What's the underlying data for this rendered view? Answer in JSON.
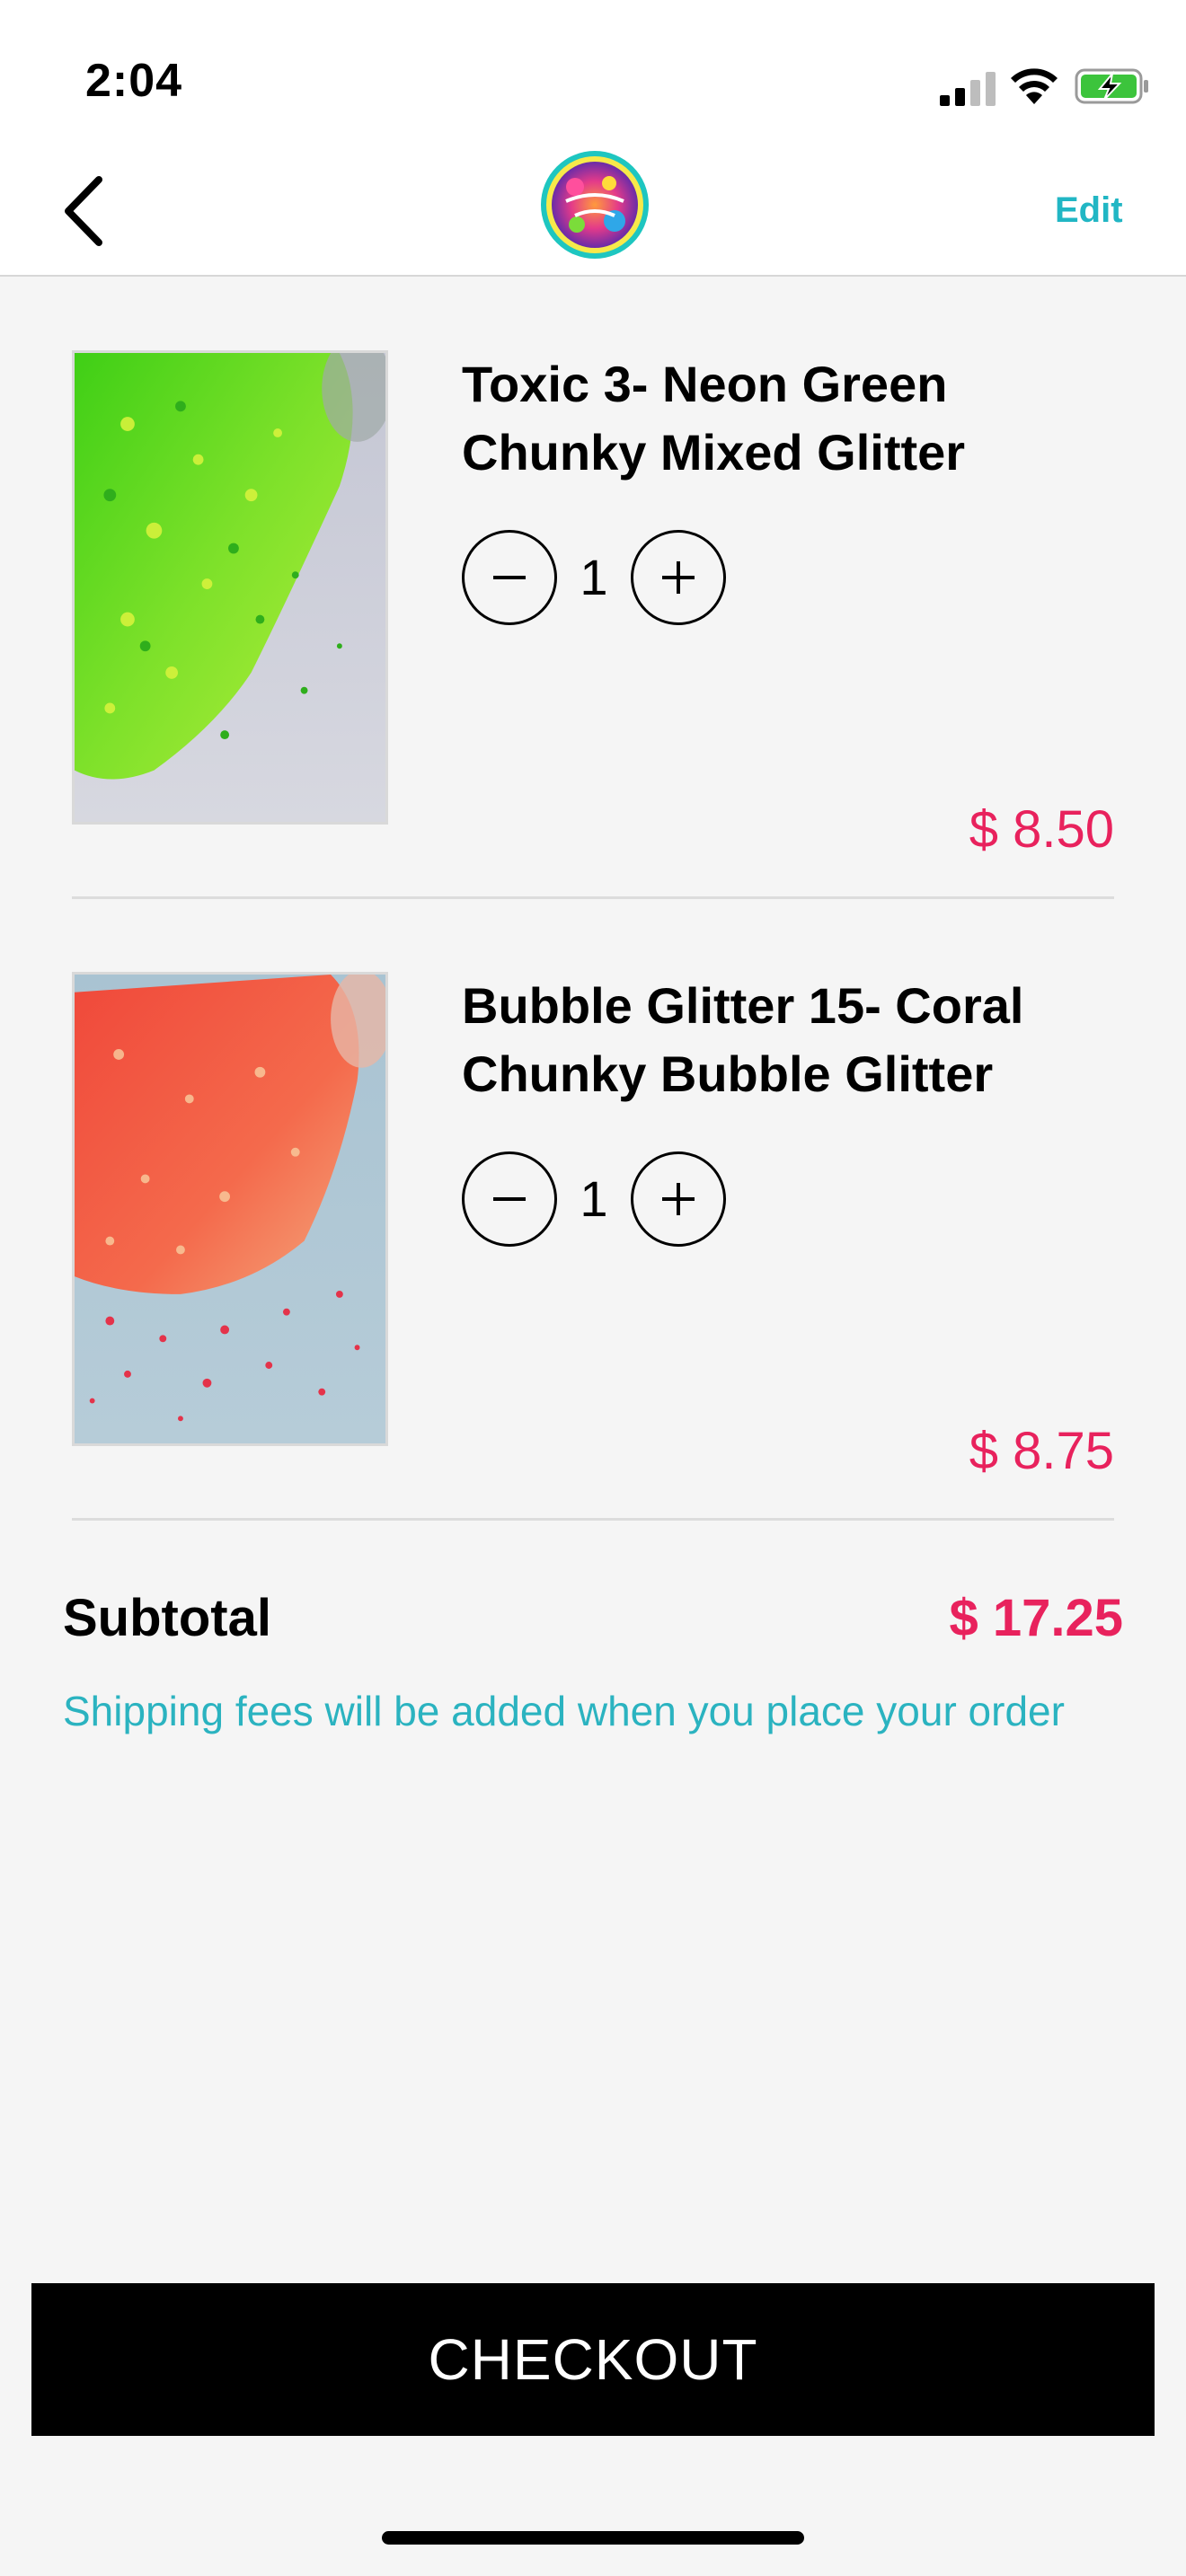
{
  "status_bar": {
    "time": "2:04"
  },
  "nav": {
    "logo_alt": "Custom by Estee",
    "edit_label": "Edit"
  },
  "cart": {
    "items": [
      {
        "title_line1": "Toxic 3- Neon Green",
        "title_line2": "Chunky Mixed Glitter",
        "quantity": "1",
        "price": "$ 8.50",
        "thumb_colors": [
          "#4fd41e",
          "#9ef23a",
          "#c9c9d6"
        ]
      },
      {
        "title_line1": "Bubble Glitter 15- Coral",
        "title_line2": "Chunky Bubble Glitter",
        "quantity": "1",
        "price": "$ 8.75",
        "thumb_colors": [
          "#ef4a3a",
          "#f7a07a",
          "#a8c4d0"
        ]
      }
    ]
  },
  "summary": {
    "subtotal_label": "Subtotal",
    "subtotal_value": "$ 17.25",
    "shipping_note": "Shipping fees will be added when you place your order"
  },
  "checkout_label": "CHECKOUT",
  "colors": {
    "accent_pink": "#e8225d",
    "accent_teal": "#21b6c4",
    "background": "#f5f5f5"
  }
}
